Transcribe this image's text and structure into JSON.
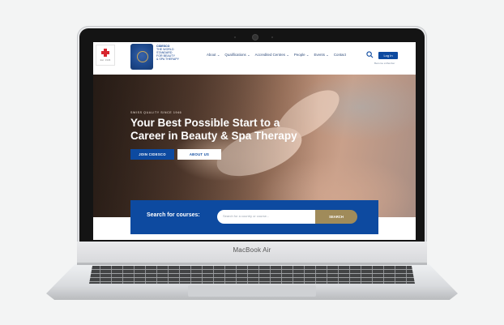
{
  "device": {
    "brand": "MacBook Air"
  },
  "site": {
    "swiss_badge": "Est. 1946",
    "logo_lines": [
      "CIDESCO",
      "THE WORLD",
      "STANDARD",
      "FOR BEAUTY",
      "& SPA THERAPY"
    ],
    "nav": [
      {
        "label": "About"
      },
      {
        "label": "Qualifications"
      },
      {
        "label": "Accredited Centres"
      },
      {
        "label": "People"
      },
      {
        "label": "Events"
      },
      {
        "label": "Contact"
      }
    ],
    "login_label": "Log In",
    "members_label": "Become a Member"
  },
  "hero": {
    "eyebrow": "SWISS QUALITY SINCE 1946",
    "headline": "Your Best Possible Start to a Career in Beauty & Spa Therapy",
    "primary_button": "JOIN CIDESCO",
    "secondary_button": "ABOUT US"
  },
  "course_search": {
    "label": "Search for courses:",
    "placeholder": "Search for a country or course...",
    "button": "SEARCH"
  },
  "colors": {
    "brand_blue": "#0d4aa0",
    "search_gold": "#a08b5a",
    "swiss_red": "#d7262e"
  }
}
